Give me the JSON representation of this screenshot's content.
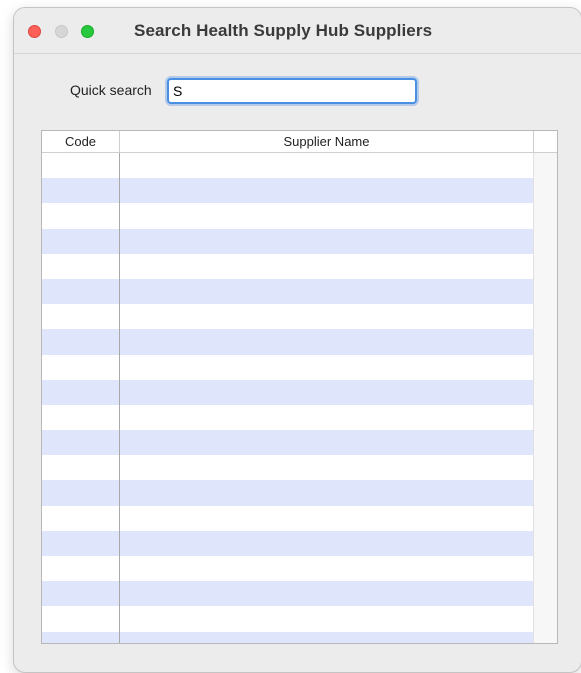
{
  "window": {
    "title": "Search Health Supply Hub Suppliers"
  },
  "search": {
    "label": "Quick search",
    "value": "S"
  },
  "table": {
    "columns": [
      "Code",
      "Supplier Name"
    ],
    "rows": []
  }
}
